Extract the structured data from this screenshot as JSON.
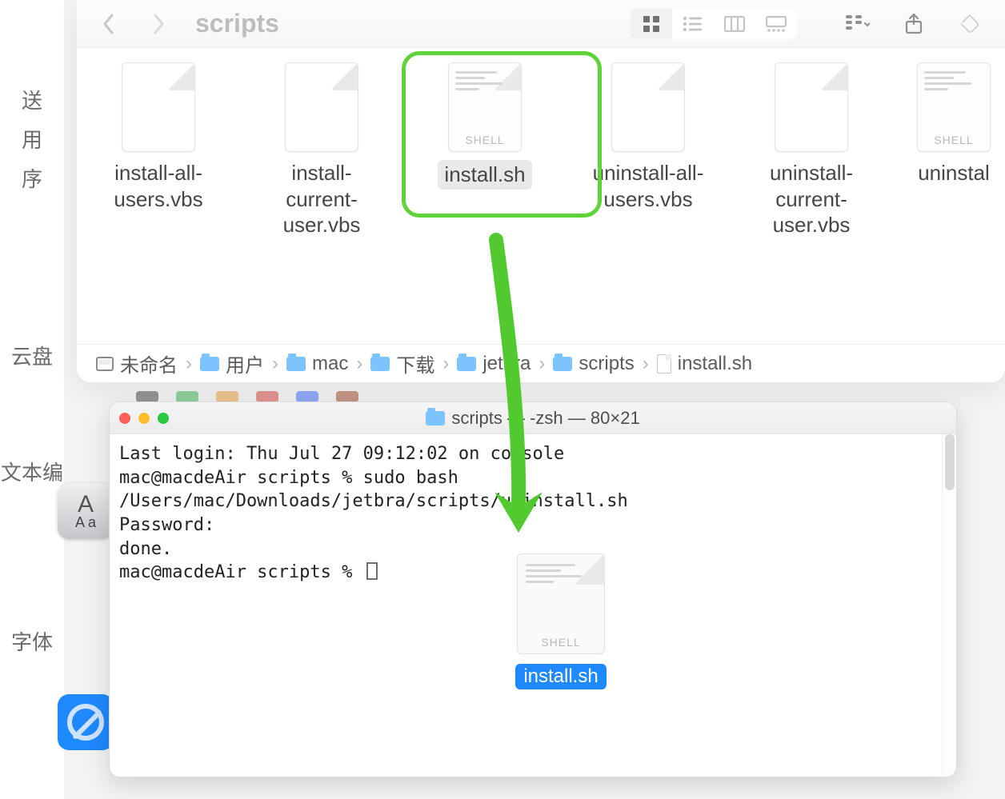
{
  "sidebar": {
    "txt1": "送",
    "txt2": "用",
    "txt3": "序",
    "txt4": "云盘",
    "txt5": "文本编",
    "txt6": "字体"
  },
  "finder": {
    "title": "scripts",
    "toolbar": {
      "back": "‹",
      "forward": "›"
    },
    "files": [
      {
        "name": "install-all-users.vbs",
        "type": "plain"
      },
      {
        "name": "install-current-user.vbs",
        "type": "plain"
      },
      {
        "name": "install.sh",
        "type": "shell",
        "selected": true
      },
      {
        "name": "uninstall-all-users.vbs",
        "type": "plain"
      },
      {
        "name": "uninstall-current-user.vbs",
        "type": "plain"
      },
      {
        "name": "uninstal",
        "type": "shell_peek"
      }
    ],
    "shell_tag": "SHELL",
    "path": {
      "disk": "未命名",
      "users": "用户",
      "user": "mac",
      "downloads": "下载",
      "dir1": "jetbra",
      "dir2": "scripts",
      "file": "install.sh"
    }
  },
  "terminal": {
    "title_text": "scripts — -zsh — 80×21",
    "lines": {
      "l1": "Last login: Thu Jul 27 09:12:02 on console",
      "l2": "mac@macdeAir scripts % sudo bash /Users/mac/Downloads/jetbra/scripts/uninstall.sh",
      "l3": "Password:",
      "l4": "done.",
      "l5": "mac@macdeAir scripts % "
    },
    "drag_label": "install.sh"
  }
}
